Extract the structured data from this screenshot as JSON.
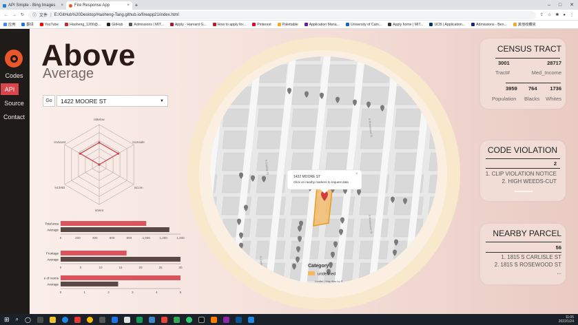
{
  "browser": {
    "tabs": [
      {
        "title": "API Simple - Bing Images"
      },
      {
        "title": "Fire Response App"
      }
    ],
    "new_tab": "+",
    "url_prefix": "文件",
    "url": "E:/GitHub%20Desktop/Haoheng-Tang.github.io/fireapp21/index.html",
    "bookmarks": [
      {
        "label": "应用",
        "color": "#4285f4"
      },
      {
        "label": "翻译",
        "color": "#1a73e8"
      },
      {
        "label": "YouTube",
        "color": "#ff0000"
      },
      {
        "label": "Haoheng_1200@...",
        "color": "#c62828"
      },
      {
        "label": "GitHub",
        "color": "#222222"
      },
      {
        "label": "Admissions | MIT...",
        "color": "#555555"
      },
      {
        "label": "Apply - Harvard G...",
        "color": "#a51c30"
      },
      {
        "label": "How to apply for...",
        "color": "#b71c1c"
      },
      {
        "label": "Pinterest",
        "color": "#e60023"
      },
      {
        "label": "Palettable",
        "color": "#f9a825"
      },
      {
        "label": "Application Mana...",
        "color": "#6a1b9a"
      },
      {
        "label": "University of Cam...",
        "color": "#1565c0"
      },
      {
        "label": "Apply home | MIT...",
        "color": "#333333"
      },
      {
        "label": "UCB | Application...",
        "color": "#003262"
      },
      {
        "label": "Admissions - Ben...",
        "color": "#1a237e"
      },
      {
        "label": "其他收藏夹",
        "color": "#f9a825"
      }
    ]
  },
  "nav": {
    "items": [
      {
        "label": "Codes",
        "active": false
      },
      {
        "label": "API",
        "active": true
      },
      {
        "label": "Source",
        "active": false
      },
      {
        "label": "Contact",
        "active": false
      }
    ]
  },
  "header": {
    "title": "Above",
    "subtitle": "Average"
  },
  "search": {
    "go_label": "Go",
    "address": "1422 MOORE ST"
  },
  "chart_data": [
    {
      "type": "radar",
      "axes": [
        "isBelow",
        "isUnsafe",
        "isCom",
        "isVent",
        "isCMID",
        "isVacant"
      ],
      "values": [
        0.55,
        0.55,
        0.0,
        0.0,
        0.0,
        0.55
      ],
      "color": "#c8464b"
    },
    {
      "type": "bar",
      "categories": [
        "Total area",
        "Average"
      ],
      "values": [
        1000,
        1270
      ],
      "colors": [
        "#d9545c",
        "#5a4844"
      ],
      "xticks": [
        "0",
        "200",
        "400",
        "600",
        "800",
        "1,000",
        "1,200",
        "1,400"
      ],
      "xlim": [
        0,
        1400
      ]
    },
    {
      "type": "bar",
      "categories": [
        "Frontage",
        "Average"
      ],
      "values": [
        16.5,
        30
      ],
      "colors": [
        "#d9545c",
        "#5a4844"
      ],
      "xticks": [
        "0",
        "5",
        "10",
        "15",
        "20",
        "25",
        "30"
      ],
      "xlim": [
        0,
        30
      ]
    },
    {
      "type": "bar",
      "categories": [
        "e of rooms",
        "Average"
      ],
      "values": [
        5,
        2.4
      ],
      "colors": [
        "#d9545c",
        "#5a4844"
      ],
      "xticks": [
        "0",
        "1",
        "2",
        "3",
        "4",
        "5"
      ],
      "xlim": [
        0,
        5
      ]
    }
  ],
  "map": {
    "popup_line1": "1422 MOORE ST",
    "popup_line2": "Click on nearby markers to request data",
    "popup_close": "×",
    "streets": [
      "S Carlisle St",
      "S Rosewood St",
      "S Carlisle St",
      "S Rosewood St"
    ],
    "legend_title": "Category",
    "legend_item": "undefined",
    "attribution": "Leaflet | Map tiles by S..."
  },
  "census": {
    "title": "CENSUS TRACT",
    "tract": "3001",
    "tract_label": "Tract#",
    "income": "28717",
    "income_label": "Med_Income",
    "population": "3959",
    "population_label": "Population",
    "blacks": "764",
    "blacks_label": "Blacks",
    "whites": "1736",
    "whites_label": "Whites"
  },
  "code_violation": {
    "title": "CODE VIOLATION",
    "count": "2",
    "items": [
      "1. CLIP VIOLATION NOTICE",
      "2. HIGH WEEDS-CUT"
    ]
  },
  "nearby_parcel": {
    "title": "NEARBY PARCEL",
    "count": "56",
    "items": [
      "1. 1815 S CARLISLE ST",
      "2. 1815 S ROSEWOOD ST",
      "..."
    ]
  },
  "taskbar": {
    "time": "11:05",
    "date": "2022/1/24"
  }
}
